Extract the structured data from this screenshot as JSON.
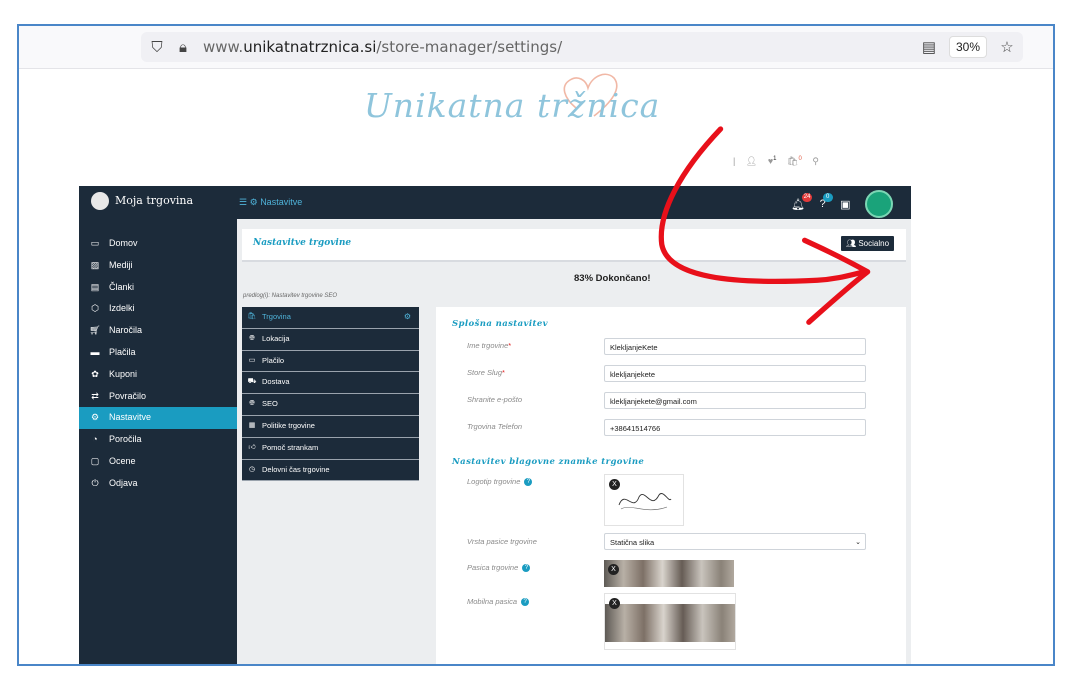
{
  "browser": {
    "url_prefix": "www.",
    "url_domain": "unikatnatrznica.si",
    "url_path": "/store-manager/settings/",
    "zoom": "30%"
  },
  "site": {
    "logo_text": "Unikatna tržnica"
  },
  "mini_icons": {
    "badge_a": "1",
    "badge_b": "0"
  },
  "app": {
    "brand": "Moja trgovina",
    "breadcrumb": "Nastavitve",
    "top_badges": {
      "notifications": "24",
      "help": "0"
    }
  },
  "sidebar": {
    "items": [
      {
        "label": "Domov",
        "icon": "monitor-icon"
      },
      {
        "label": "Mediji",
        "icon": "image-icon"
      },
      {
        "label": "Članki",
        "icon": "document-icon"
      },
      {
        "label": "Izdelki",
        "icon": "box-icon"
      },
      {
        "label": "Naročila",
        "icon": "cart-icon"
      },
      {
        "label": "Plačila",
        "icon": "card-icon"
      },
      {
        "label": "Kuponi",
        "icon": "gift-icon"
      },
      {
        "label": "Povračilo",
        "icon": "refund-icon"
      },
      {
        "label": "Nastavitve",
        "icon": "gear-icon",
        "active": true
      },
      {
        "label": "Poročila",
        "icon": "pie-chart-icon"
      },
      {
        "label": "Ocene",
        "icon": "comment-icon"
      },
      {
        "label": "Odjava",
        "icon": "power-icon"
      }
    ]
  },
  "page": {
    "header_title": "Nastavitve trgovine",
    "social_button": "Socialno",
    "progress": "83% Dokončano!",
    "predlog": "predlog(i): Nastavitev trgovine SEO"
  },
  "leftmenu": {
    "items": [
      {
        "label": "Trgovina",
        "active": true
      },
      {
        "label": "Lokacija"
      },
      {
        "label": "Plačilo"
      },
      {
        "label": "Dostava"
      },
      {
        "label": "SEO"
      },
      {
        "label": "Politike trgovine"
      },
      {
        "label": "Pomoč strankam"
      },
      {
        "label": "Delovni čas trgovine"
      }
    ]
  },
  "general": {
    "title": "Splošna nastavitev",
    "fields": [
      {
        "label": "Ime trgovine",
        "required": true,
        "value": "KlekljanjeKete"
      },
      {
        "label": "Store Slug",
        "required": true,
        "value": "klekljanjekete"
      },
      {
        "label": "Shranite e-pošto",
        "required": false,
        "value": "klekljanjekete@gmail.com"
      },
      {
        "label": "Trgovina Telefon",
        "required": false,
        "value": "+38641514766"
      }
    ],
    "required_mark": "*"
  },
  "brand": {
    "title": "Nastavitev blagovne znamke trgovine",
    "logo_label": "Logotip trgovine",
    "banner_type_label": "Vrsta pasice trgovine",
    "banner_type_value": "Statična slika",
    "banner_label": "Pasica trgovine",
    "mobile_banner_label": "Mobilna pasica",
    "remove_x": "X",
    "info": "?"
  },
  "colors": {
    "accent": "#1a9cc1",
    "dark": "#1c2b3a",
    "arrow": "#e8101a"
  }
}
